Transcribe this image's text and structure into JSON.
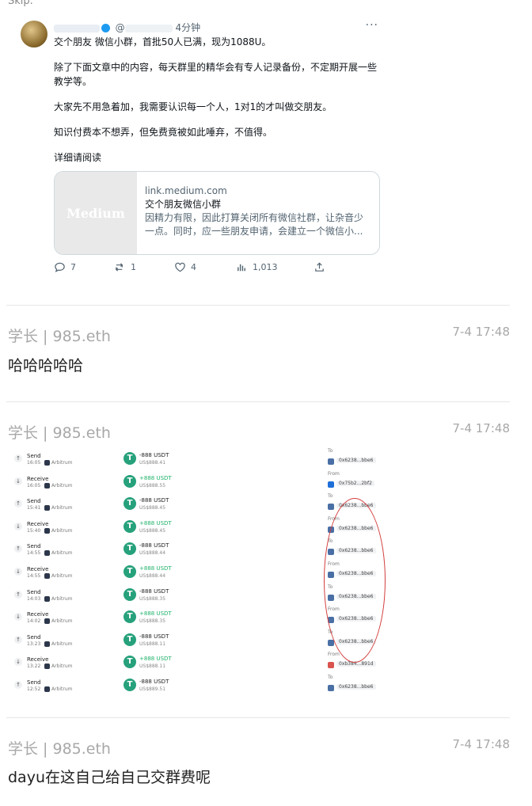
{
  "top_fragment": "Skip.",
  "tweet": {
    "time": "4分钟",
    "paragraphs": [
      "交个朋友 微信小群，首批50人已满，现为1088U。",
      "除了下面文章中的内容，每天群里的精华会有专人记录备份，不定期开展一些教学等。",
      "大家先不用急着加，我需要认识每一个人，1对1的才叫做交朋友。",
      "知识付费本不想弄，但免费竟被如此唾弃，不值得。",
      "详细请阅读"
    ],
    "link_card": {
      "thumb_text": "Medium",
      "domain": "link.medium.com",
      "title": "交个朋友微信小群",
      "desc": "因精力有限，因此打算关闭所有微信社群，让杂音少一点。同时，应一些朋友申请，会建立一个微信小..."
    },
    "actions": {
      "replies": "7",
      "retweets": "1",
      "likes": "4",
      "views": "1,013"
    }
  },
  "comments": [
    {
      "user": "学长 | 985.eth",
      "time": "7-4 17:48",
      "text": "哈哈哈哈哈"
    },
    {
      "user": "学长 | 985.eth",
      "time": "7-4 17:48",
      "text": ""
    },
    {
      "user": "学长 | 985.eth",
      "time": "7-4 17:48",
      "text": "dayu在这自己给自己交群费呢"
    }
  ],
  "transactions": [
    {
      "type": "Send",
      "time": "16:05",
      "network": "Arbitrum",
      "amount": "-888 USDT",
      "usd": "US$888.41",
      "dir_label": "To",
      "addr": "0x6238...bbe6"
    },
    {
      "type": "Receive",
      "time": "16:05",
      "network": "Arbitrum",
      "amount": "+888 USDT",
      "usd": "US$888.55",
      "dir_label": "From",
      "addr": "0x75b2...2bf2"
    },
    {
      "type": "Send",
      "time": "15:41",
      "network": "Arbitrum",
      "amount": "-888 USDT",
      "usd": "US$888.45",
      "dir_label": "To",
      "addr": "0x6238...bbe6"
    },
    {
      "type": "Receive",
      "time": "15:40",
      "network": "Arbitrum",
      "amount": "+888 USDT",
      "usd": "US$888.45",
      "dir_label": "From",
      "addr": "0x6238...bbe6"
    },
    {
      "type": "Send",
      "time": "14:55",
      "network": "Arbitrum",
      "amount": "-888 USDT",
      "usd": "US$888.44",
      "dir_label": "To",
      "addr": "0x6238...bbe6"
    },
    {
      "type": "Receive",
      "time": "14:55",
      "network": "Arbitrum",
      "amount": "+888 USDT",
      "usd": "US$888.44",
      "dir_label": "From",
      "addr": "0x6238...bbe6"
    },
    {
      "type": "Send",
      "time": "14:03",
      "network": "Arbitrum",
      "amount": "-888 USDT",
      "usd": "US$888.35",
      "dir_label": "To",
      "addr": "0x6238...bbe6"
    },
    {
      "type": "Receive",
      "time": "14:02",
      "network": "Arbitrum",
      "amount": "+888 USDT",
      "usd": "US$888.35",
      "dir_label": "From",
      "addr": "0x6238...bbe6"
    },
    {
      "type": "Send",
      "time": "13:23",
      "network": "Arbitrum",
      "amount": "-888 USDT",
      "usd": "US$888.11",
      "dir_label": "To",
      "addr": "0x6238...bbe6"
    },
    {
      "type": "Receive",
      "time": "13:22",
      "network": "Arbitrum",
      "amount": "+888 USDT",
      "usd": "US$888.11",
      "dir_label": "From",
      "addr": "0xb384...891d"
    },
    {
      "type": "Send",
      "time": "12:52",
      "network": "Arbitrum",
      "amount": "-888 USDT",
      "usd": "US$889.51",
      "dir_label": "To",
      "addr": "0x6238...bbe6"
    }
  ]
}
